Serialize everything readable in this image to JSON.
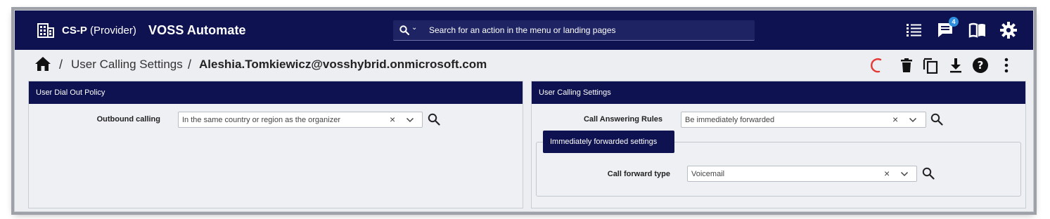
{
  "navbar": {
    "org_name": "CS-P",
    "org_type": "(Provider)",
    "app_title": "VOSS Automate",
    "search_placeholder": "Search for an action in the menu or landing pages",
    "notification_count": "4",
    "icons": [
      "building-icon",
      "search-icon",
      "list-icon",
      "chat-icon",
      "book-icon",
      "gear-icon"
    ]
  },
  "breadcrumb": {
    "separator": "/",
    "page": "User Calling Settings",
    "current": "Aleshia.Tomkiewicz@vosshybrid.onmicrosoft.com"
  },
  "toolbar": {
    "icons": [
      "loading-icon",
      "delete-icon",
      "copy-icon",
      "download-icon",
      "help-icon",
      "more-icon"
    ],
    "accent_color": "#e53935"
  },
  "left_panel": {
    "title": "User Dial Out Policy",
    "fields": [
      {
        "label": "Outbound calling",
        "value": "In the same country or region as the organizer"
      }
    ]
  },
  "right_panel": {
    "title": "User Calling Settings",
    "fields": [
      {
        "label": "Call Answering Rules",
        "value": "Be immediately forwarded"
      }
    ],
    "subgroup": {
      "title": "Immediately forwarded settings",
      "fields": [
        {
          "label": "Call forward type",
          "value": "Voicemail"
        }
      ]
    }
  },
  "colors": {
    "navy": "#0e1250",
    "panel_bg": "#eef0f4",
    "badge": "#2f8fdc"
  }
}
